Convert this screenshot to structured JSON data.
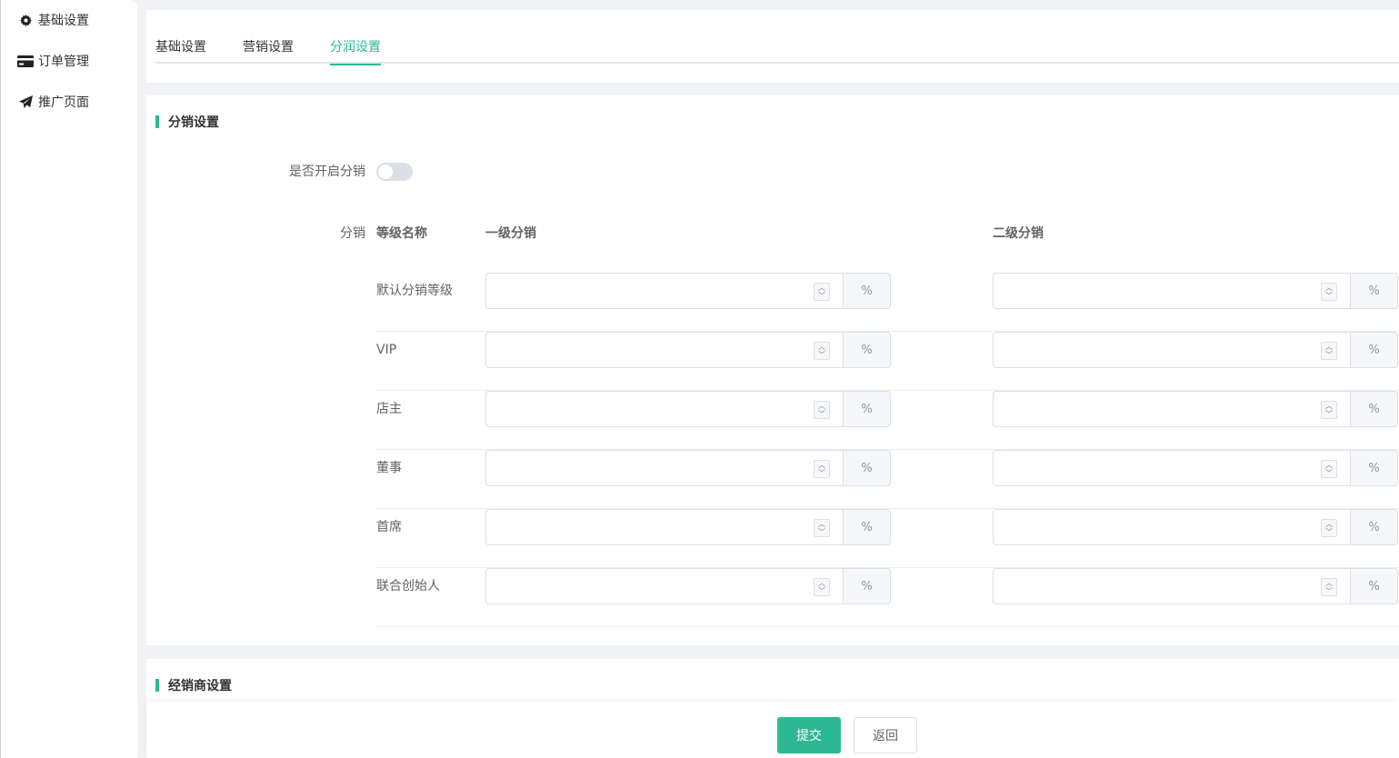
{
  "sidebar": {
    "items": [
      {
        "label": "基础设置",
        "icon": "gear-icon"
      },
      {
        "label": "订单管理",
        "icon": "credit-card-icon"
      },
      {
        "label": "推广页面",
        "icon": "paper-plane-icon"
      }
    ]
  },
  "tabs": [
    {
      "label": "基础设置",
      "active": false
    },
    {
      "label": "营销设置",
      "active": false
    },
    {
      "label": "分润设置",
      "active": true
    }
  ],
  "distribution": {
    "section_title": "分销设置",
    "enable_label": "是否开启分销",
    "enabled": false,
    "levels_label": "分销",
    "col_level_name": "等级名称",
    "col_first": "一级分销",
    "col_second": "二级分销",
    "unit": "%",
    "rows": [
      {
        "name": "默认分销等级",
        "first": "",
        "second": ""
      },
      {
        "name": "VIP",
        "first": "",
        "second": ""
      },
      {
        "name": "店主",
        "first": "",
        "second": ""
      },
      {
        "name": "董事",
        "first": "",
        "second": ""
      },
      {
        "name": "首席",
        "first": "",
        "second": ""
      },
      {
        "name": "联合创始人",
        "first": "",
        "second": ""
      }
    ]
  },
  "dealer": {
    "section_title": "经销商设置"
  },
  "footer": {
    "submit_label": "提交",
    "back_label": "返回"
  },
  "colors": {
    "accent": "#2db894"
  }
}
